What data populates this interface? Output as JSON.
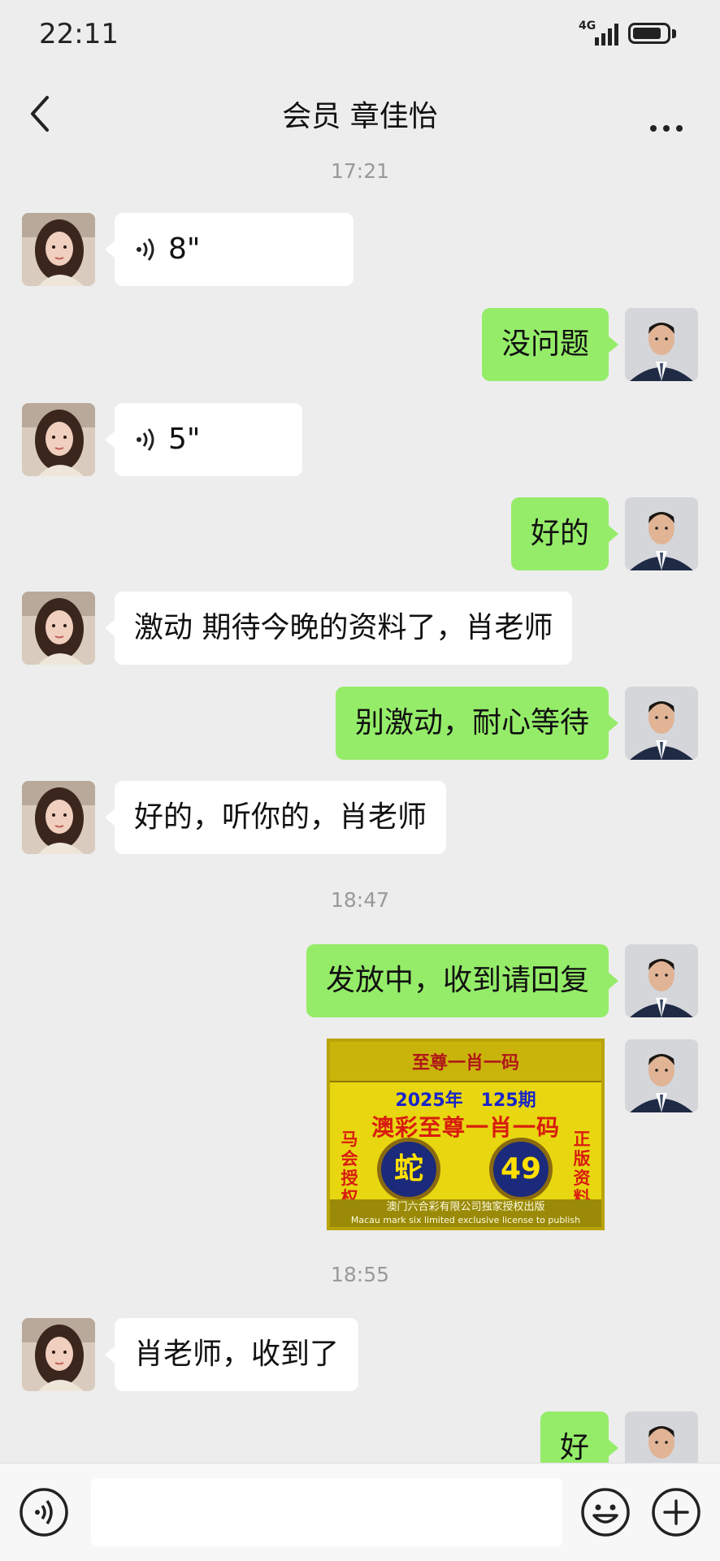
{
  "status_bar": {
    "time": "22:11",
    "network": "4G",
    "battery_percent": 85
  },
  "header": {
    "title": "会员 章佳怡",
    "back_icon": "chevron-left-icon",
    "more_icon": "more-dots-icon"
  },
  "timestamps": [
    "17:21",
    "18:47",
    "18:55"
  ],
  "messages": [
    {
      "side": "in",
      "type": "voice",
      "text": "8\""
    },
    {
      "side": "out",
      "type": "text",
      "text": "没问题"
    },
    {
      "side": "in",
      "type": "voice",
      "text": "5\""
    },
    {
      "side": "out",
      "type": "text",
      "text": "好的"
    },
    {
      "side": "in",
      "type": "text",
      "text": "激动 期待今晚的资料了，肖老师"
    },
    {
      "side": "out",
      "type": "text",
      "text": "别激动，耐心等待"
    },
    {
      "side": "in",
      "type": "text",
      "text": "好的，听你的，肖老师"
    },
    {
      "side": "out",
      "type": "text",
      "text": "发放中，收到请回复"
    },
    {
      "side": "out",
      "type": "image",
      "image": {
        "top_title": "至尊一肖一码",
        "year_issue": "2025年　125期",
        "headline": "澳彩至尊一肖一码",
        "left_side": "马会授权",
        "right_side": "正版资料",
        "ball_zodiac": "蛇",
        "ball_number": "49",
        "footer_cn": "澳门六合彩有限公司独家授权出版",
        "footer_en": "Macau mark six limited exclusive license to publish"
      }
    },
    {
      "side": "in",
      "type": "text",
      "text": "肖老师，收到了"
    },
    {
      "side": "out",
      "type": "text",
      "text": "好"
    }
  ],
  "input_bar": {
    "voice_icon": "voice-icon",
    "emoji_icon": "emoji-icon",
    "plus_icon": "plus-icon"
  },
  "colors": {
    "outgoing_bubble": "#95ec69",
    "incoming_bubble": "#ffffff",
    "background": "#ededed"
  }
}
